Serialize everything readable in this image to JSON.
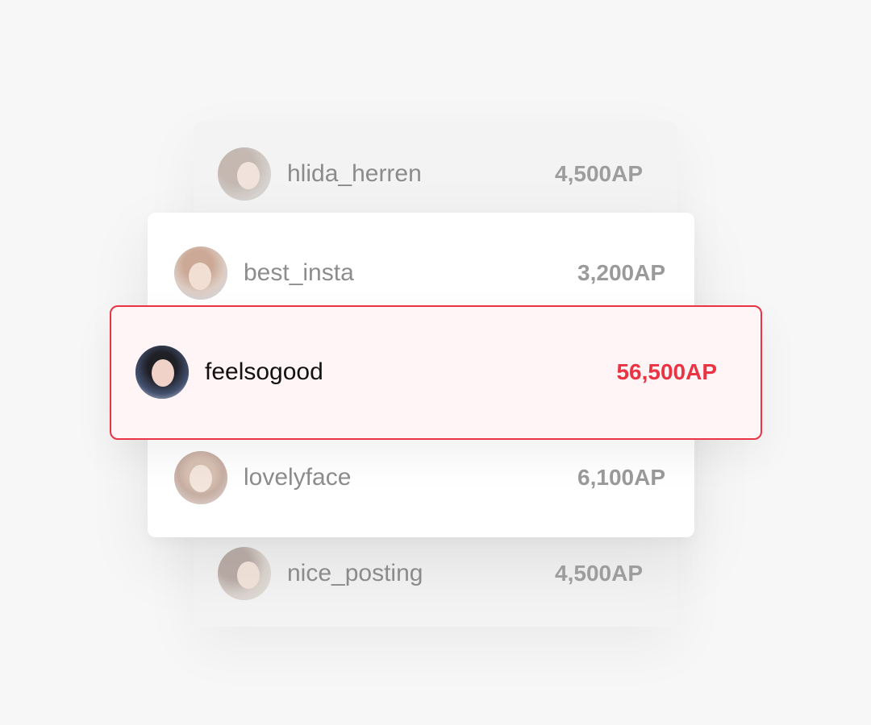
{
  "leaderboard": {
    "rows": [
      {
        "username": "hlida_herren",
        "points": "4,500AP",
        "avatar": "avatar-photo"
      },
      {
        "username": "best_insta",
        "points": "3,200AP",
        "avatar": "avatar-photo"
      },
      {
        "username": "feelsogood",
        "points": "56,500AP",
        "avatar": "avatar-photo",
        "highlighted": true
      },
      {
        "username": "lovelyface",
        "points": "6,100AP",
        "avatar": "avatar-photo"
      },
      {
        "username": "nice_posting",
        "points": "4,500AP",
        "avatar": "avatar-photo"
      }
    ]
  },
  "colors": {
    "highlight_border": "#ea3343",
    "highlight_background": "#fff5f6",
    "highlight_points": "#ea3343",
    "muted_text": "#8b8b8b"
  }
}
